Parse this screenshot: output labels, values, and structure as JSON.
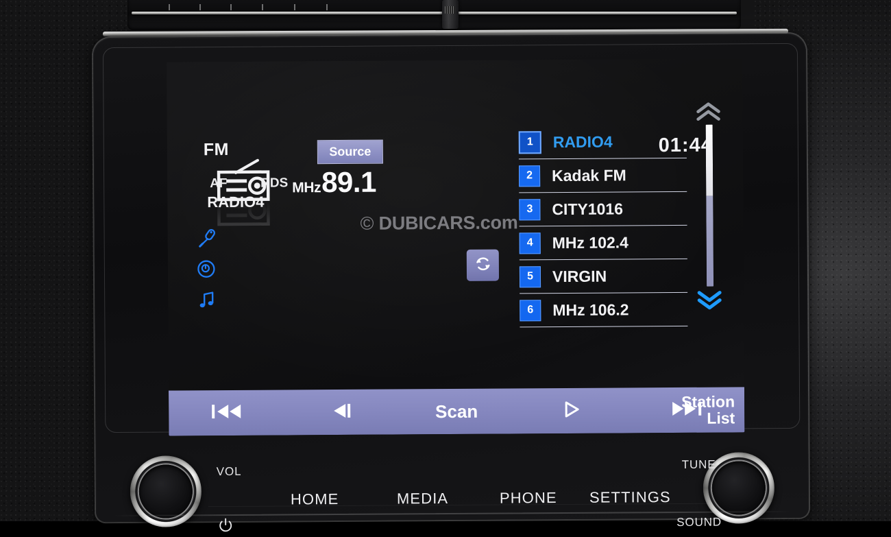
{
  "screen": {
    "band": "FM",
    "source_button": "Source",
    "clock": "01:44",
    "af_indicator": "AF",
    "rds_indicator": "RDS",
    "program_service_name": "RADIO4",
    "frequency": {
      "unit": "MHz",
      "value": "89.1"
    },
    "watermark": {
      "copyright": "©",
      "text": "DUBICARS.com"
    },
    "side_icons": [
      {
        "name": "microphone-icon"
      },
      {
        "name": "disc-icon"
      },
      {
        "name": "music-note-icon"
      }
    ],
    "refresh_button": {
      "name": "refresh-icon"
    },
    "station_list": {
      "items": [
        {
          "number": "1",
          "name": "RADIO4",
          "selected": true
        },
        {
          "number": "2",
          "name": "Kadak FM",
          "selected": false
        },
        {
          "number": "3",
          "name": "CITY1016",
          "selected": false
        },
        {
          "number": "4",
          "name": "MHz   102.4",
          "selected": false
        },
        {
          "number": "5",
          "name": "VIRGIN",
          "selected": false
        },
        {
          "number": "6",
          "name": "MHz   106.2",
          "selected": false
        }
      ]
    },
    "scroll": {
      "up_icon": "chevron-up-icon",
      "down_icon": "chevron-down-icon"
    },
    "toolbar": {
      "prev_track": "previous-track-icon",
      "step_back": "step-back-icon",
      "scan_label": "Scan",
      "step_forward": "step-forward-icon",
      "next_track": "next-track-icon",
      "station_list_line1": "Station",
      "station_list_line2": "List"
    }
  },
  "hardware": {
    "vol_label": "VOL",
    "tune_label": "TUNE",
    "sound_label": "SOUND",
    "power_icon": "power-icon",
    "buttons": [
      {
        "label": "HOME"
      },
      {
        "label": "MEDIA"
      },
      {
        "label": "PHONE"
      },
      {
        "label": "SETTINGS"
      }
    ]
  },
  "colors": {
    "accent_blue": "#1166f0",
    "selected_text": "#2e9bf0",
    "toolbar_purple": "#8587bf",
    "source_button": "#8a8dc2",
    "screen_bg": "#121213",
    "chevron_active": "#1e9bff",
    "chevron_inactive": "#8f9299"
  }
}
